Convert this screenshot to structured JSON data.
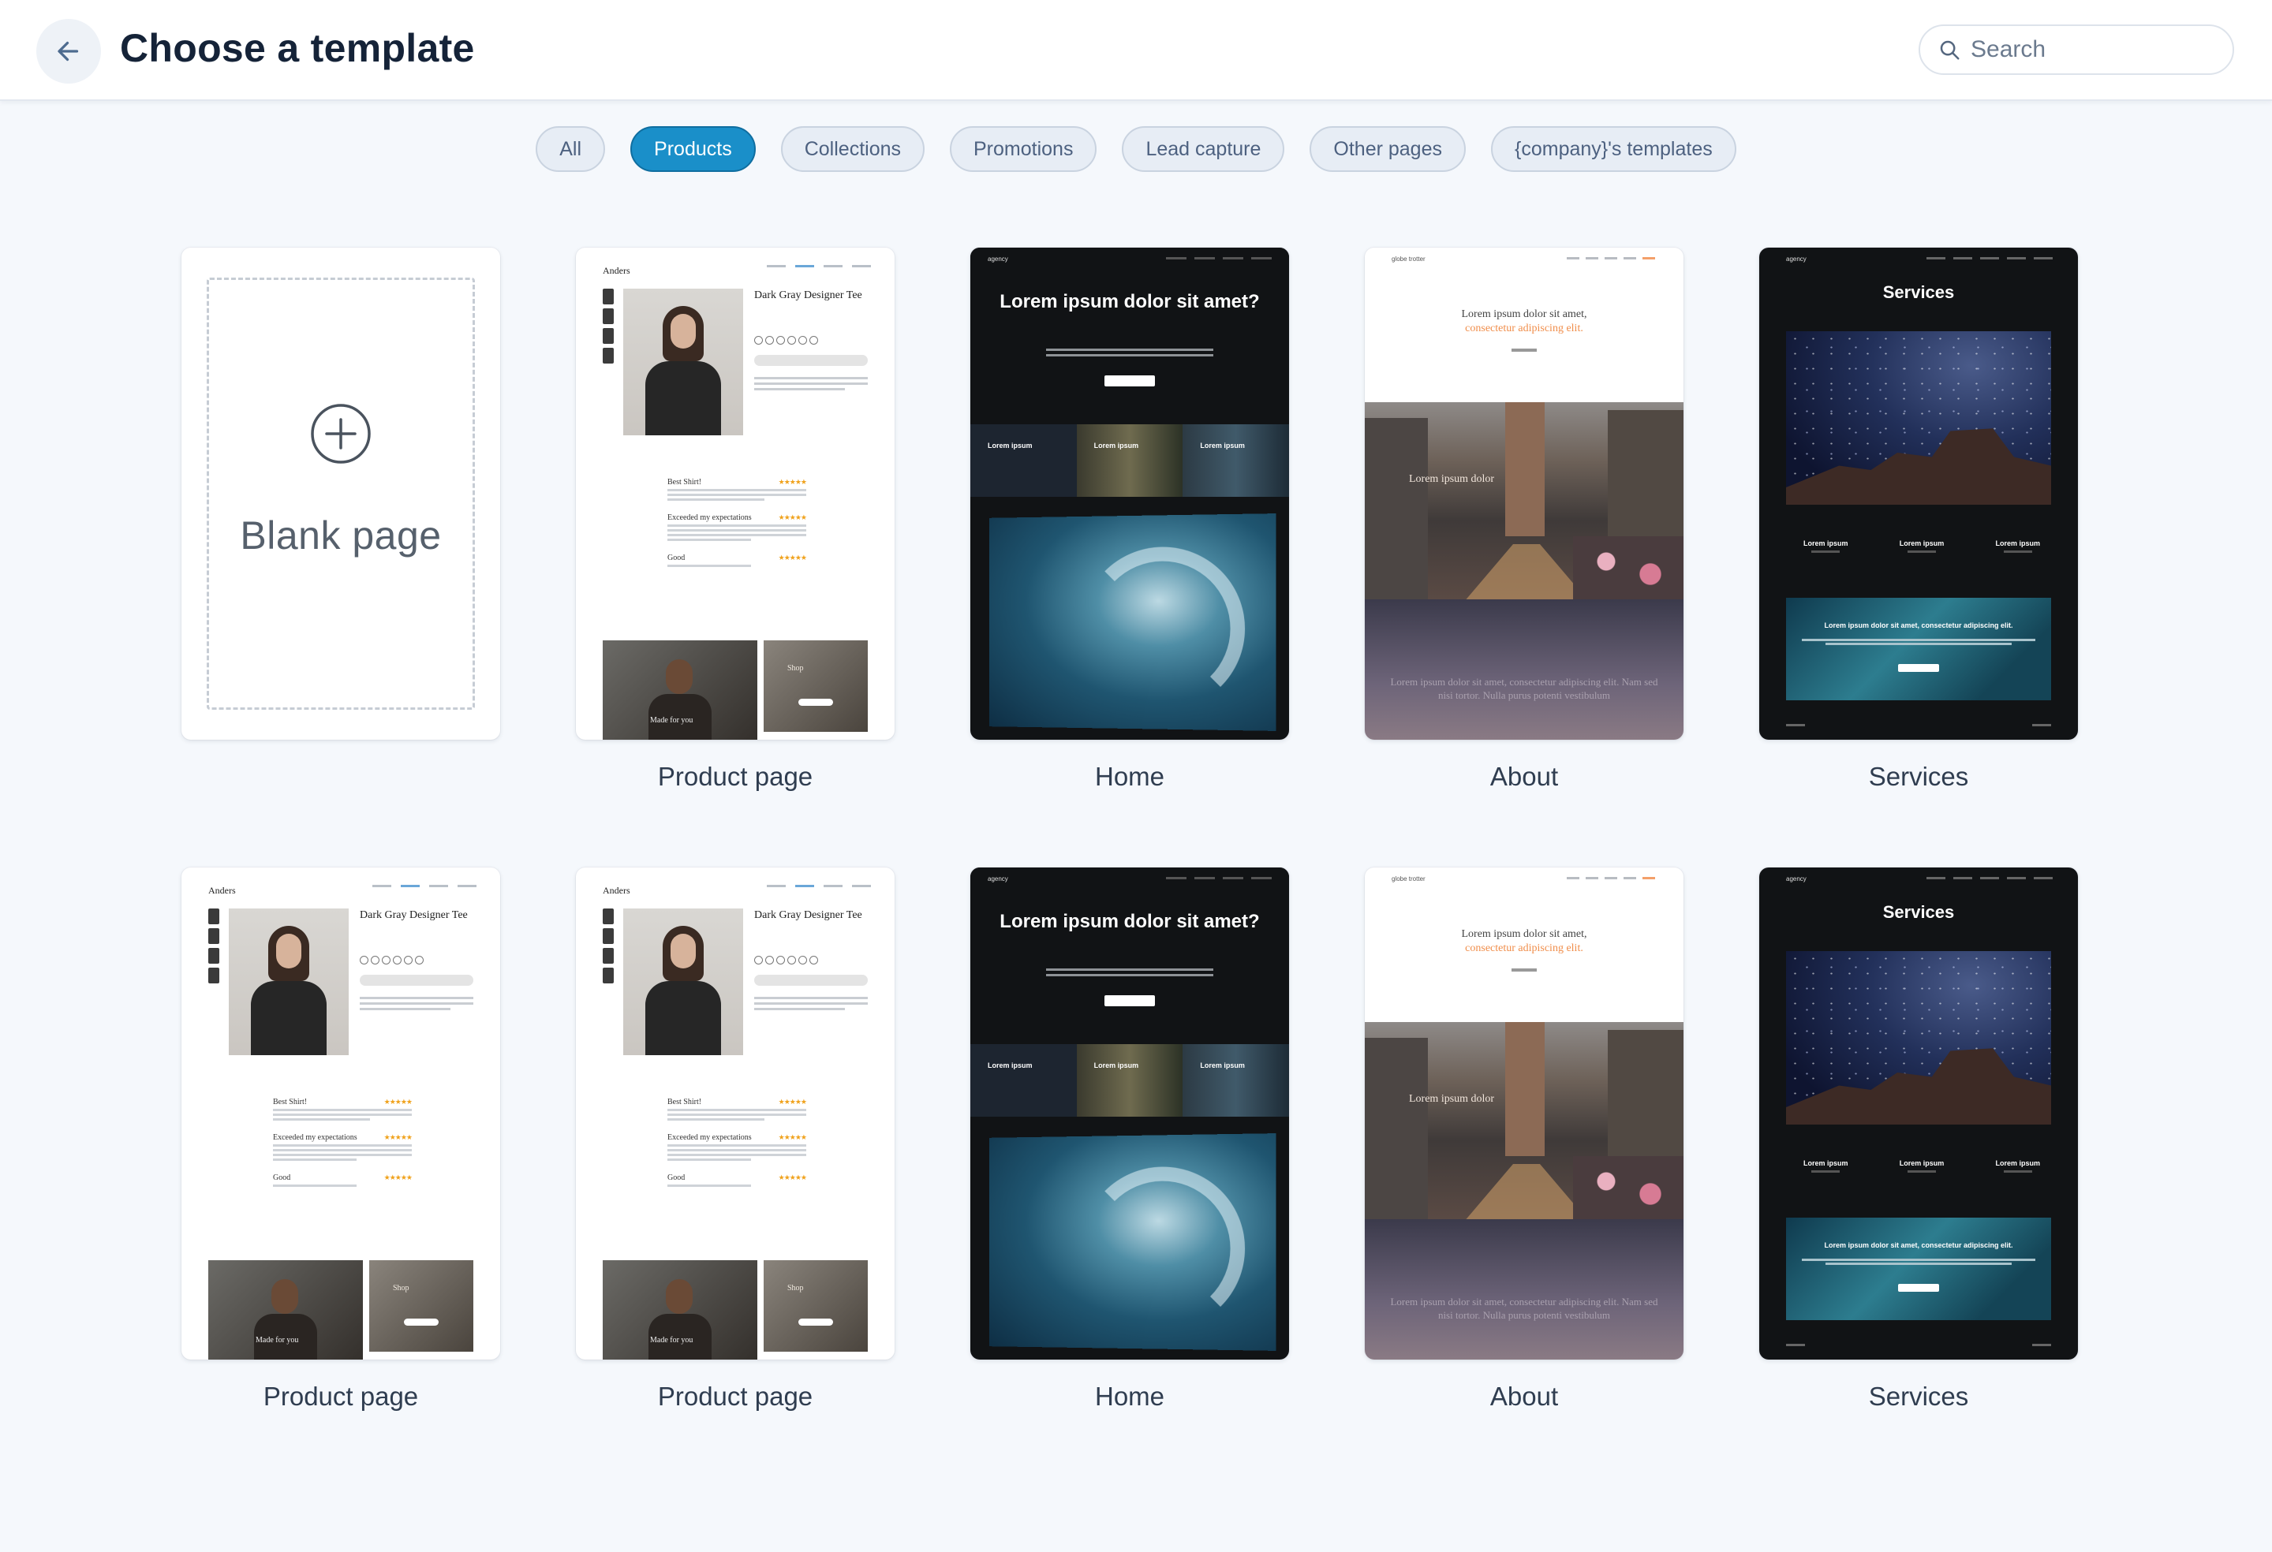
{
  "header": {
    "title": "Choose a template",
    "search_placeholder": "Search"
  },
  "filters": [
    {
      "label": "All",
      "active": false
    },
    {
      "label": "Products",
      "active": true
    },
    {
      "label": "Collections",
      "active": false
    },
    {
      "label": "Promotions",
      "active": false
    },
    {
      "label": "Lead capture",
      "active": false
    },
    {
      "label": "Other pages",
      "active": false
    },
    {
      "label": "{company}'s templates",
      "active": false
    }
  ],
  "blank": {
    "text": "Blank page"
  },
  "cards": [
    {
      "label": "Product page"
    },
    {
      "label": "Home"
    },
    {
      "label": "About"
    },
    {
      "label": "Services"
    },
    {
      "label": "Product page"
    },
    {
      "label": "Product page"
    },
    {
      "label": "Home"
    },
    {
      "label": "About"
    },
    {
      "label": "Services"
    }
  ],
  "mock": {
    "product": {
      "logo": "Anders",
      "title": "Dark Gray Designer Tee",
      "reviews": [
        "Best Shirt!",
        "Exceeded my expectations",
        "Good"
      ],
      "stars": "★★★★★",
      "caption1": "Made for you",
      "caption2": "Shop"
    },
    "home": {
      "logo": "agency",
      "title": "Lorem ipsum dolor sit amet?",
      "strip": [
        "Lorem ipsum",
        "Lorem ipsum",
        "Lorem ipsum"
      ]
    },
    "about": {
      "logo": "globe trotter",
      "title_a": "Lorem ipsum dolor sit amet,",
      "title_b": "consectetur adipiscing elit.",
      "town_text": "Lorem ipsum dolor",
      "sky_text": "Lorem ipsum dolor sit amet, consectetur adipiscing elit. Nam sed nisi tortor. Nulla purus potenti vestibulum"
    },
    "services": {
      "logo": "agency",
      "title": "Services",
      "cols": [
        "Lorem ipsum",
        "Lorem ipsum",
        "Lorem ipsum"
      ],
      "ocean_text": "Lorem ipsum dolor sit amet, consectetur adipiscing elit."
    }
  },
  "colors": {
    "accent": "#1a8fc9",
    "background": "#f5f8fc",
    "chip_bg": "#e7edf5"
  }
}
